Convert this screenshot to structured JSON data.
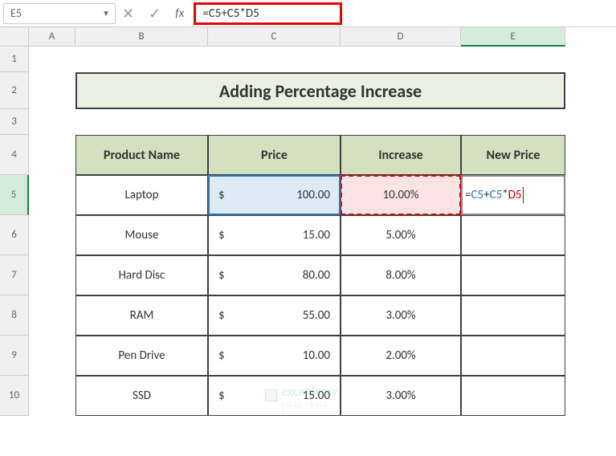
{
  "name_box": "E5",
  "fx_label": "fx",
  "formula": "=C5+C5*D5",
  "col_labels": {
    "A": "A",
    "B": "B",
    "C": "C",
    "D": "D",
    "E": "E"
  },
  "row_labels": {
    "r1": "1",
    "r2": "2",
    "r3": "3",
    "r4": "4",
    "r5": "5",
    "r6": "6",
    "r7": "7",
    "r8": "8",
    "r9": "9",
    "r10": "10"
  },
  "title": "Adding Percentage Increase",
  "headers": {
    "product": "Product Name",
    "price": "Price",
    "increase": "Increase",
    "new_price": "New Price"
  },
  "currency": "$",
  "rows": [
    {
      "product": "Laptop",
      "price": "100.00",
      "increase": "10.00%"
    },
    {
      "product": "Mouse",
      "price": "15.00",
      "increase": "5.00%"
    },
    {
      "product": "Hard Disc",
      "price": "80.00",
      "increase": "8.00%"
    },
    {
      "product": "RAM",
      "price": "55.00",
      "increase": "3.00%"
    },
    {
      "product": "Pen Drive",
      "price": "10.00",
      "increase": "2.00%"
    },
    {
      "product": "SSD",
      "price": "15.00",
      "increase": "3.00%"
    }
  ],
  "inline_formula": {
    "eq": "=",
    "r1": "C5",
    "plus": "+",
    "r2": "C5",
    "star": "*",
    "r3": "D5"
  },
  "watermark": {
    "brand": "exceldemy",
    "tag": "EXCEL · DATA · BI"
  },
  "chart_data": {
    "type": "table",
    "title": "Adding Percentage Increase",
    "columns": [
      "Product Name",
      "Price",
      "Increase",
      "New Price"
    ],
    "rows": [
      [
        "Laptop",
        100.0,
        0.1,
        null
      ],
      [
        "Mouse",
        15.0,
        0.05,
        null
      ],
      [
        "Hard Disc",
        80.0,
        0.08,
        null
      ],
      [
        "RAM",
        55.0,
        0.03,
        null
      ],
      [
        "Pen Drive",
        10.0,
        0.02,
        null
      ],
      [
        "SSD",
        15.0,
        0.03,
        null
      ]
    ],
    "formula_in_E5": "=C5+C5*D5"
  }
}
